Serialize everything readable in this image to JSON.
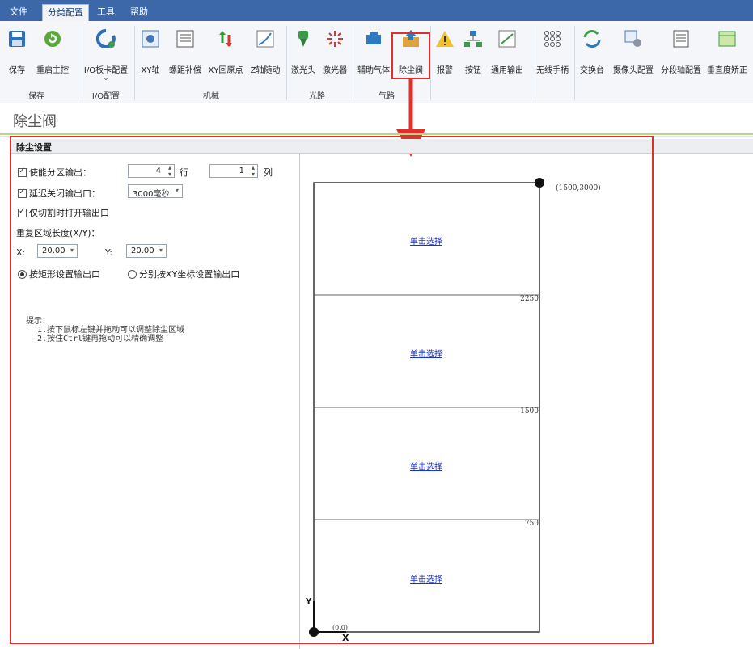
{
  "menu": {
    "tabs": [
      {
        "label": "文件"
      },
      {
        "label": "分类配置"
      },
      {
        "label": "工具"
      },
      {
        "label": "帮助"
      }
    ]
  },
  "ribbon": {
    "buttons": [
      {
        "label": "保存",
        "icon": "save-icon"
      },
      {
        "label": "重启主控",
        "icon": "restart-icon"
      },
      {
        "label": "I/O板卡配置",
        "icon": "io-card-icon",
        "sub": "⌄"
      },
      {
        "label": "XY轴",
        "icon": "xy-axis-icon"
      },
      {
        "label": "螺距补偿",
        "icon": "pitch-comp-icon"
      },
      {
        "label": "XY回原点",
        "icon": "xy-home-icon"
      },
      {
        "label": "Z轴随动",
        "icon": "z-follow-icon"
      },
      {
        "label": "激光头",
        "icon": "laser-head-icon"
      },
      {
        "label": "激光器",
        "icon": "laser-icon"
      },
      {
        "label": "辅助气体",
        "icon": "gas-icon"
      },
      {
        "label": "除尘阀",
        "icon": "dust-valve-icon"
      },
      {
        "label": "报警",
        "icon": "alarm-icon"
      },
      {
        "label": "按钮",
        "icon": "button-icon"
      },
      {
        "label": "通用输出",
        "icon": "output-icon"
      },
      {
        "label": "无线手柄",
        "icon": "remote-icon"
      },
      {
        "label": "交换台",
        "icon": "exchange-icon"
      },
      {
        "label": "摄像头配置",
        "icon": "camera-config-icon"
      },
      {
        "label": "分段轴配置",
        "icon": "segment-axis-icon"
      },
      {
        "label": "垂直度矫正",
        "icon": "vertical-correct-icon"
      }
    ],
    "groups": [
      {
        "label": "保存"
      },
      {
        "label": "I/O配置"
      },
      {
        "label": "机械"
      },
      {
        "label": "光路"
      },
      {
        "label": "气路"
      }
    ]
  },
  "page": {
    "title": "除尘阀"
  },
  "panel": {
    "header": "除尘设置",
    "enable_zone_output": {
      "label": "使能分区输出：",
      "rows_value": "4",
      "rows_unit": "行",
      "cols_value": "1",
      "cols_unit": "列"
    },
    "delay_close": {
      "label": "延迟关闭输出口：",
      "value": "3000毫秒"
    },
    "open_on_cut": {
      "label": "仅切割时打开输出口"
    },
    "overlap_label": "重复区域长度(X/Y)：",
    "x_label": "X:",
    "x_value": "20.00",
    "y_label": "Y:",
    "y_value": "20.00",
    "mode_rect": "按矩形设置输出口",
    "mode_xy": "分别按XY坐标设置输出口",
    "tip_title": "提示：",
    "tip_line1": "1.按下鼠标左键并拖动可以调整除尘区域",
    "tip_line2": "2.按住Ctrl键再拖动可以精确调整"
  },
  "diagram": {
    "corner_top": "(1500,3000)",
    "corner_origin": "(0,0)",
    "axis_x": "X",
    "axis_y": "Y",
    "dividers": [
      "2250",
      "1500",
      "750"
    ],
    "zones": [
      {
        "label": "单击选择"
      },
      {
        "label": "单击选择"
      },
      {
        "label": "单击选择"
      },
      {
        "label": "单击选择"
      }
    ]
  },
  "colors": {
    "menubar": "#3c67a8",
    "highlight": "#e0302c",
    "link": "#1a33cc",
    "title_underline": "#b8d68a"
  }
}
